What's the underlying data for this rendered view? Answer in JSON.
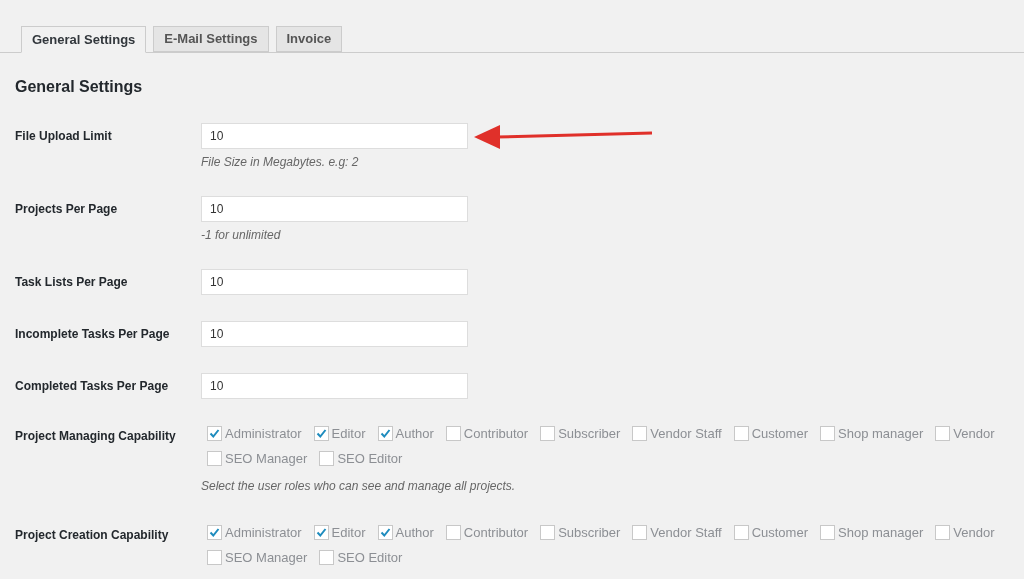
{
  "tabs": [
    {
      "label": "General Settings",
      "selected": true
    },
    {
      "label": "E-Mail Settings",
      "selected": false
    },
    {
      "label": "Invoice",
      "selected": false
    }
  ],
  "heading": "General Settings",
  "settings": [
    {
      "kind": "text",
      "label": "File Upload Limit",
      "value": "10",
      "description": "File Size in Megabytes. e.g: 2"
    },
    {
      "kind": "text",
      "label": "Projects Per Page",
      "value": "10",
      "description": "-1 for unlimited"
    },
    {
      "kind": "text",
      "label": "Task Lists Per Page",
      "value": "10"
    },
    {
      "kind": "text",
      "label": "Incomplete Tasks Per Page",
      "value": "10"
    },
    {
      "kind": "text",
      "label": "Completed Tasks Per Page",
      "value": "10"
    },
    {
      "kind": "roles",
      "label": "Project Managing Capability",
      "description": "Select the user roles who can see and manage all projects.",
      "roles": [
        {
          "label": "Administrator",
          "checked": true
        },
        {
          "label": "Editor",
          "checked": true
        },
        {
          "label": "Author",
          "checked": true
        },
        {
          "label": "Contributor",
          "checked": false
        },
        {
          "label": "Subscriber",
          "checked": false
        },
        {
          "label": "Vendor Staff",
          "checked": false
        },
        {
          "label": "Customer",
          "checked": false
        },
        {
          "label": "Shop manager",
          "checked": false
        },
        {
          "label": "Vendor",
          "checked": false
        },
        {
          "label": "SEO Manager",
          "checked": false
        },
        {
          "label": "SEO Editor",
          "checked": false
        }
      ]
    },
    {
      "kind": "roles",
      "label": "Project Creation Capability",
      "roles": [
        {
          "label": "Administrator",
          "checked": true
        },
        {
          "label": "Editor",
          "checked": true
        },
        {
          "label": "Author",
          "checked": true
        },
        {
          "label": "Contributor",
          "checked": false
        },
        {
          "label": "Subscriber",
          "checked": false
        },
        {
          "label": "Vendor Staff",
          "checked": false
        },
        {
          "label": "Customer",
          "checked": false
        },
        {
          "label": "Shop manager",
          "checked": false
        },
        {
          "label": "Vendor",
          "checked": false
        },
        {
          "label": "SEO Manager",
          "checked": false
        },
        {
          "label": "SEO Editor",
          "checked": false
        }
      ]
    }
  ]
}
